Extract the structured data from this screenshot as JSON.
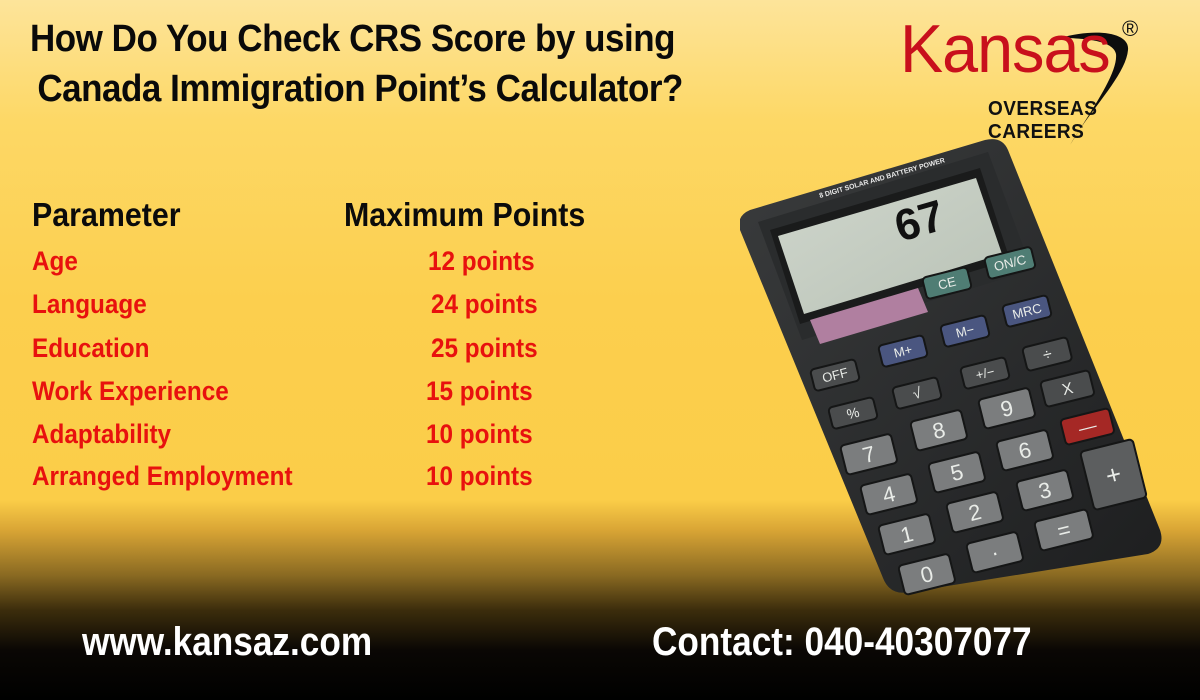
{
  "title": {
    "line1": "How Do You Check CRS Score by using",
    "line2": "Canada Immigration Point’s Calculator?"
  },
  "logo": {
    "brand": "Kansas",
    "registered": "®",
    "tagline": "OVERSEAS CAREERS",
    "brand_color": "#c8101c"
  },
  "table": {
    "headers": {
      "parameter": "Parameter",
      "max_points": "Maximum Points"
    },
    "rows": [
      {
        "parameter": "Age",
        "points": "12 points"
      },
      {
        "parameter": "Language",
        "points": "24 points"
      },
      {
        "parameter": "Education",
        "points": "25 points"
      },
      {
        "parameter": "Work Experience",
        "points": "15 points"
      },
      {
        "parameter": "Adaptability",
        "points": "10 points"
      },
      {
        "parameter": "Arranged Employment",
        "points": "10 points"
      }
    ],
    "row_color": "#e8110e"
  },
  "calculator": {
    "display_value": "67",
    "model_text": "8 DIGIT SOLAR AND BATTERY POWER",
    "keys": {
      "ce": "CE",
      "on_c": "ON/C",
      "mrc": "MRC",
      "m_minus": "M−",
      "m_plus": "M+",
      "divide": "÷",
      "off": "OFF",
      "sqrt": "√",
      "plus_minus": "+/−",
      "multiply": "X",
      "percent": "%",
      "nine": "9",
      "eight": "8",
      "seven": "7",
      "minus": "—",
      "six": "6",
      "five": "5",
      "four": "4",
      "plus": "+",
      "three": "3",
      "two": "2",
      "one": "1",
      "zero": "0",
      "dot": "·",
      "equals": "="
    }
  },
  "footer": {
    "website": "www.kansaz.com",
    "contact": "Contact: 040-40307077"
  }
}
